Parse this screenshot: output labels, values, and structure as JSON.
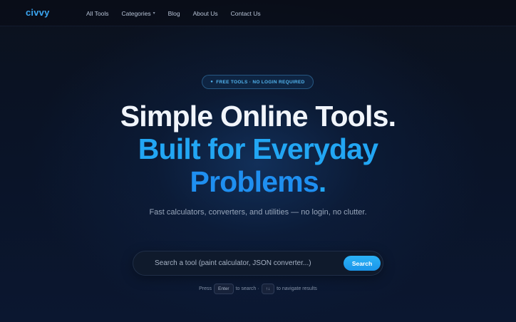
{
  "brand": {
    "logo": "civvy"
  },
  "nav": {
    "items": [
      {
        "label": "All Tools"
      },
      {
        "label": "Categories",
        "has_dropdown": true,
        "caret": "▾"
      },
      {
        "label": "Blog"
      },
      {
        "label": "About Us"
      },
      {
        "label": "Contact Us"
      }
    ]
  },
  "hero": {
    "badge_dot": "●",
    "badge": "FREE TOOLS · NO LOGIN REQUIRED",
    "title_line1": "Simple Online Tools.",
    "title_line2": "Built for Everyday",
    "title_line3": "Problems",
    "title_line3_punct": ".",
    "subtitle": "Fast calculators, converters, and utilities — no login, no clutter."
  },
  "search": {
    "placeholder": "Search a tool (paint calculator, JSON converter...)",
    "value": "",
    "button_label": "Search"
  },
  "hint": {
    "press": "Press",
    "enter_key": "Enter",
    "to_search": "to search ·",
    "arrow_keys": "↑↓",
    "navigate": "to navigate results"
  },
  "colors": {
    "accent": "#22a6f3",
    "accent_dark": "#1f8ff0",
    "background": "#0a1020",
    "title": "#f1f5fb"
  }
}
